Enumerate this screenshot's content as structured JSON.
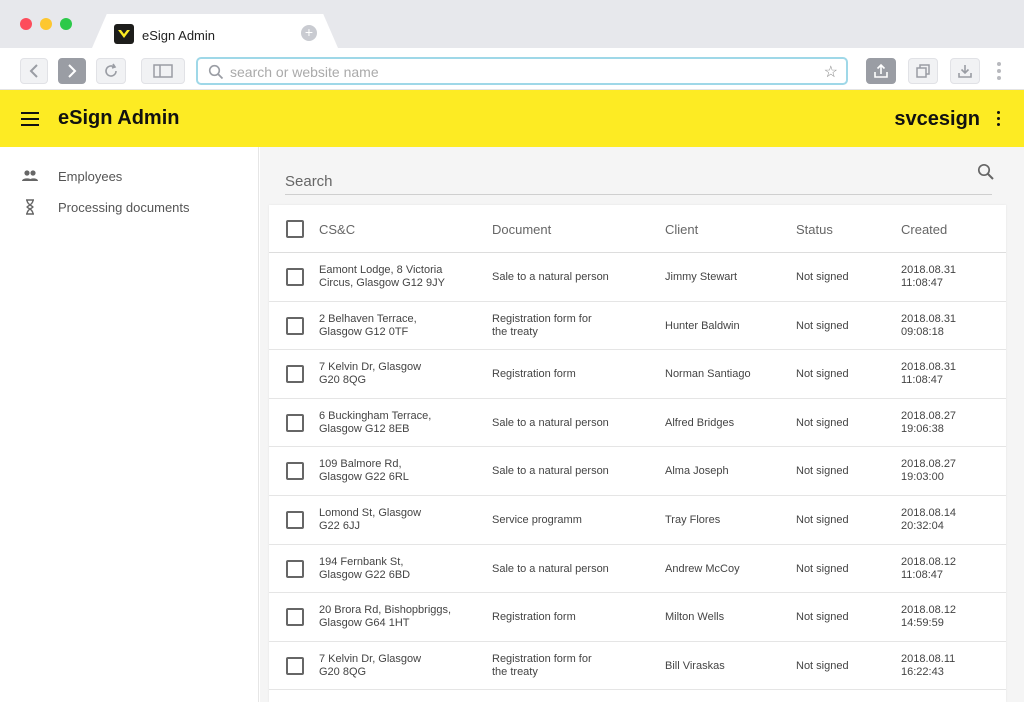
{
  "browser": {
    "tab_title": "eSign Admin",
    "new_tab_symbol": "+",
    "url_placeholder": "search or website name"
  },
  "app": {
    "title": "eSign Admin",
    "user": "svcesign",
    "accent_color": "#fdeb23"
  },
  "sidebar": {
    "items": [
      {
        "label": "Employees",
        "icon": "people-icon"
      },
      {
        "label": "Processing documents",
        "icon": "hourglass-icon"
      }
    ]
  },
  "search": {
    "placeholder": "Search"
  },
  "table": {
    "columns": [
      "CS&C",
      "Document",
      "Client",
      "Status",
      "Created"
    ],
    "rows": [
      {
        "address": [
          "Eamont Lodge, 8 Victoria",
          "Circus, Glasgow G12 9JY"
        ],
        "document": [
          "Sale to a natural person",
          ""
        ],
        "client": "Jimmy Stewart",
        "status": "Not signed",
        "created": [
          "2018.08.31",
          "11:08:47"
        ]
      },
      {
        "address": [
          "2 Belhaven Terrace,",
          "Glasgow G12 0TF"
        ],
        "document": [
          "Registration form for",
          "the treaty"
        ],
        "client": "Hunter Baldwin",
        "status": "Not signed",
        "created": [
          "2018.08.31",
          "09:08:18"
        ]
      },
      {
        "address": [
          "7 Kelvin Dr, Glasgow",
          "G20 8QG"
        ],
        "document": [
          "Registration form",
          ""
        ],
        "client": "Norman Santiago",
        "status": "Not signed",
        "created": [
          "2018.08.31",
          "11:08:47"
        ]
      },
      {
        "address": [
          "6 Buckingham Terrace,",
          "Glasgow G12 8EB"
        ],
        "document": [
          "Sale to a natural person",
          ""
        ],
        "client": "Alfred Bridges",
        "status": "Not signed",
        "created": [
          "2018.08.27",
          "19:06:38"
        ]
      },
      {
        "address": [
          "109 Balmore Rd,",
          "Glasgow G22 6RL"
        ],
        "document": [
          "Sale to a natural person",
          ""
        ],
        "client": "Alma Joseph",
        "status": "Not signed",
        "created": [
          "2018.08.27",
          "19:03:00"
        ]
      },
      {
        "address": [
          "Lomond St, Glasgow",
          "G22 6JJ"
        ],
        "document": [
          "Service programm",
          ""
        ],
        "client": "Tray Flores",
        "status": "Not signed",
        "created": [
          "2018.08.14",
          "20:32:04"
        ]
      },
      {
        "address": [
          "194 Fernbank St,",
          "Glasgow G22 6BD"
        ],
        "document": [
          "Sale to a natural person",
          ""
        ],
        "client": "Andrew McCoy",
        "status": "Not signed",
        "created": [
          "2018.08.12",
          "11:08:47"
        ]
      },
      {
        "address": [
          "20 Brora Rd, Bishopbriggs,",
          "Glasgow G64 1HT"
        ],
        "document": [
          "Registration form",
          ""
        ],
        "client": "Milton Wells",
        "status": "Not signed",
        "created": [
          "2018.08.12",
          "14:59:59"
        ]
      },
      {
        "address": [
          "7 Kelvin Dr, Glasgow",
          "G20 8QG"
        ],
        "document": [
          "Registration form for",
          "the treaty"
        ],
        "client": "Bill Viraskas",
        "status": "Not signed",
        "created": [
          "2018.08.11",
          "16:22:43"
        ]
      }
    ]
  }
}
